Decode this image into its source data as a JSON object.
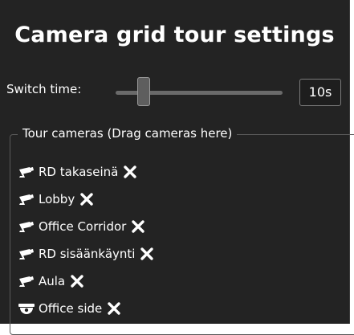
{
  "title": "Camera grid tour settings",
  "switch_time": {
    "label": "Switch time:",
    "value": "10s",
    "slider_fraction": 0.14
  },
  "tour": {
    "legend": "Tour cameras (Drag cameras here)",
    "cameras": [
      {
        "name": "RD takaseinä",
        "icon": "bullet-camera-icon"
      },
      {
        "name": "Lobby",
        "icon": "bullet-camera-icon"
      },
      {
        "name": "Office Corridor",
        "icon": "bullet-camera-icon"
      },
      {
        "name": "RD sisäänkäynti",
        "icon": "bullet-camera-icon"
      },
      {
        "name": "Aula",
        "icon": "bullet-camera-icon"
      },
      {
        "name": "Office side",
        "icon": "dome-camera-icon"
      }
    ]
  },
  "colors": {
    "panel_bg": "#232323",
    "text": "#ffffff",
    "border": "#5a5a5a"
  }
}
